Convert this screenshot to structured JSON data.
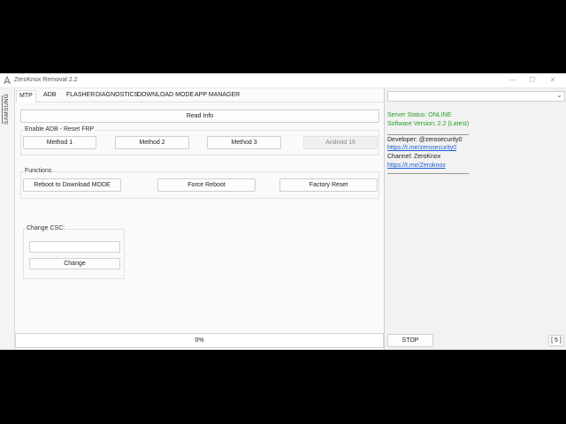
{
  "window": {
    "title": "ZeroKnox Removal 2.2",
    "minimize": "—",
    "maximize": "☐",
    "close": "✕"
  },
  "sidebar": {
    "vertical_tab": "SAMSUNG"
  },
  "tabs": [
    "MTP",
    "ADB",
    "FLASHER",
    "DIAGNOSTICS",
    "DOWNLOAD MODE",
    "APP MANAGER"
  ],
  "active_tab": "MTP",
  "mtp": {
    "read_info": "Read Info",
    "enable_adb_group": "Enable ADB - Reset FRP",
    "method1": "Method 1",
    "method2": "Method 2",
    "method3": "Method 3",
    "android16": "Android 16",
    "functions_group": "Functions",
    "reboot_download": "Reboot to Download MODE",
    "force_reboot": "Force Reboot",
    "factory_reset": "Factory Reset",
    "change_csc_group": "Change CSC:",
    "csc_value": "",
    "change_button": "Change"
  },
  "progress": {
    "percent_text": "0%",
    "value": 0
  },
  "right": {
    "device_select": "",
    "server_status": "Server Status: ONLINE",
    "software_version": "Software Version: 2.2 (Latest)",
    "developer": "Developer: @zerosecurity0",
    "developer_link": "https://t.me/zerosecurity0",
    "channel": "Channel: ZeroKnox",
    "channel_link": "https://t.me/Zeroknox",
    "stop_button": "STOP",
    "counter": "[ 5 ]"
  },
  "colors": {
    "status_green": "#2a9d2a",
    "link_blue": "#1a5fd6",
    "background": "#fafafa"
  }
}
